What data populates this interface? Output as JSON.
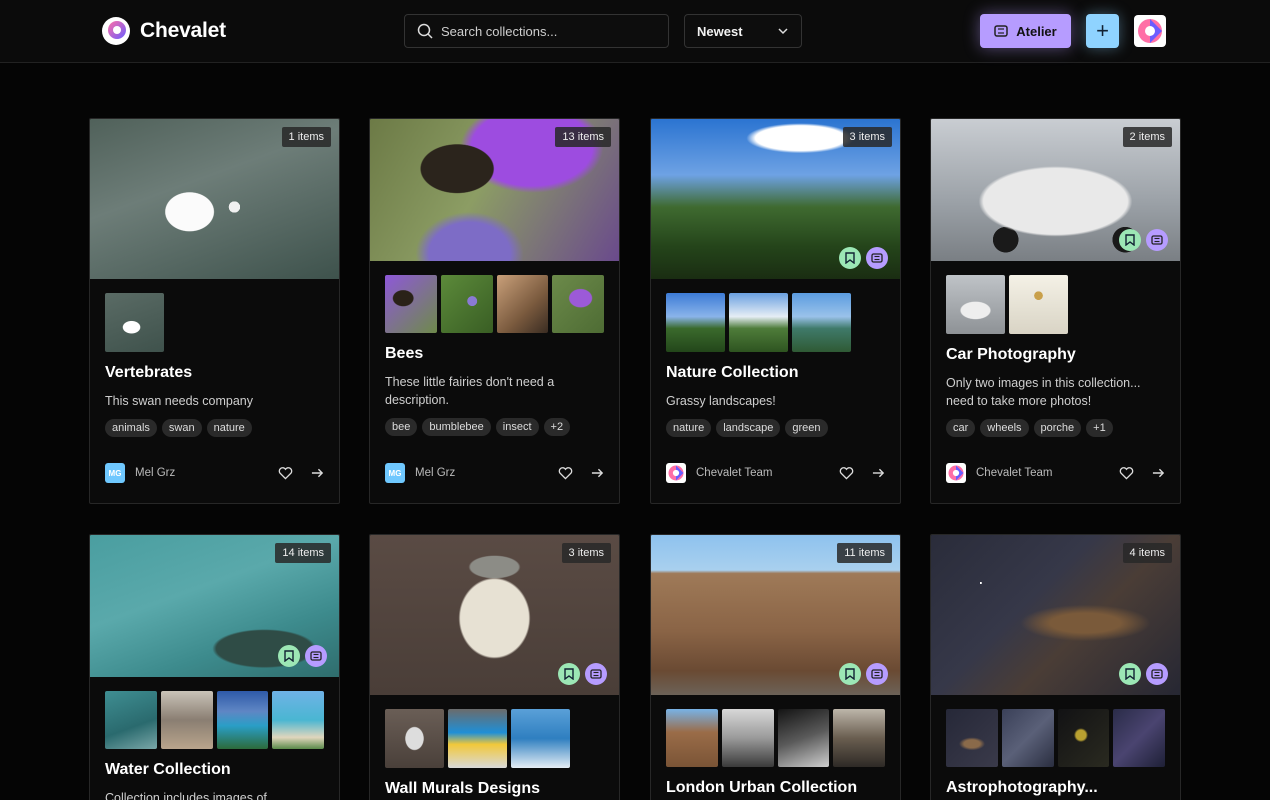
{
  "app": {
    "name": "Chevalet"
  },
  "header": {
    "search_placeholder": "Search collections...",
    "sort_value": "Newest",
    "atelier_label": "Atelier",
    "add_label": "+"
  },
  "colors": {
    "atelier": "#b69cff",
    "add": "#8fd3ff",
    "save": "#9ce7b5"
  },
  "cards": [
    {
      "count": "1 items",
      "title": "Vertebrates",
      "description": "This swan needs company",
      "tags": [
        "animals",
        "swan",
        "nature"
      ],
      "author": "Mel Grz",
      "author_initials": "MG"
    },
    {
      "count": "13 items",
      "title": "Bees",
      "description": "These little fairies don't need a description.",
      "tags": [
        "bee",
        "bumblebee",
        "insect",
        "+2"
      ],
      "author": "Mel Grz",
      "author_initials": "MG"
    },
    {
      "count": "3 items",
      "title": "Nature Collection",
      "description": "Grassy landscapes!",
      "tags": [
        "nature",
        "landscape",
        "green"
      ],
      "author": "Chevalet Team"
    },
    {
      "count": "2 items",
      "title": "Car Photography",
      "description": "Only two images in this collection... need to take more photos!",
      "tags": [
        "car",
        "wheels",
        "porche",
        "+1"
      ],
      "author": "Chevalet Team"
    },
    {
      "count": "14 items",
      "title": "Water Collection",
      "description": "Collection includes images of"
    },
    {
      "count": "3 items",
      "title": "Wall Murals Designs"
    },
    {
      "count": "11 items",
      "title": "London Urban Collection"
    },
    {
      "count": "4 items",
      "title": "Astrophotography..."
    }
  ]
}
